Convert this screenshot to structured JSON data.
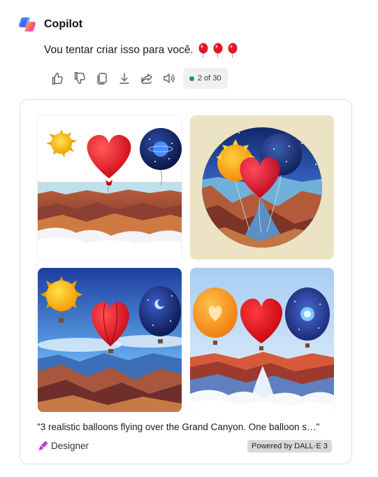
{
  "app": {
    "name": "Copilot",
    "logo_icon": "copilot-logo-icon"
  },
  "message": {
    "text": "Vou tentar criar isso para você.",
    "emoji_icons": [
      "balloon-icon",
      "balloon-icon",
      "balloon-icon"
    ],
    "emoji_color": "#e0162b"
  },
  "actions": {
    "buttons": [
      {
        "name": "like-button",
        "icon": "thumbs-up-icon"
      },
      {
        "name": "dislike-button",
        "icon": "thumbs-down-icon"
      },
      {
        "name": "copy-button",
        "icon": "copy-icon"
      },
      {
        "name": "download-button",
        "icon": "download-icon"
      },
      {
        "name": "share-button",
        "icon": "share-icon"
      },
      {
        "name": "read-aloud-button",
        "icon": "speaker-icon"
      }
    ],
    "counter": "2 of 30",
    "counter_dot_color": "#1a9e3f"
  },
  "result": {
    "images": [
      {
        "name": "generated-image-1",
        "description_icon": "balloons-canyon-image"
      },
      {
        "name": "generated-image-2",
        "description_icon": "balloons-canyon-image"
      },
      {
        "name": "generated-image-3",
        "description_icon": "balloons-canyon-image"
      },
      {
        "name": "generated-image-4",
        "description_icon": "balloons-canyon-image"
      }
    ],
    "prompt": "\"3 realistic balloons flying over the Grand Canyon. One balloon s…\"",
    "designer_label": "Designer",
    "designer_icon": "designer-icon",
    "powered_by": "Powered by DALL·E 3"
  }
}
